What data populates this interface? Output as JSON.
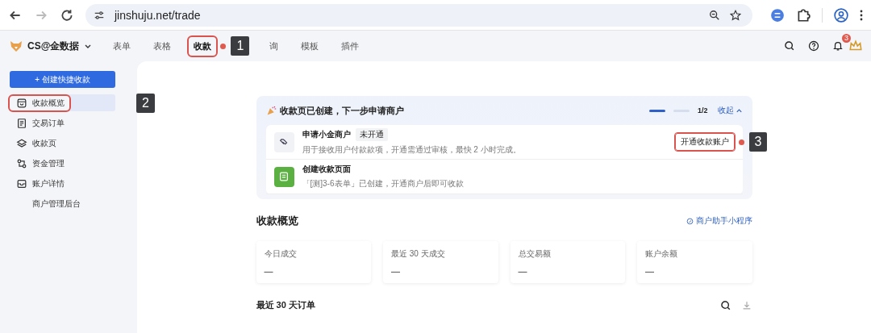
{
  "browser": {
    "url": "jinshuju.net/trade",
    "forward_disabled": true
  },
  "header": {
    "workspace": "CS@金数据",
    "notification_count": "3",
    "tabs": [
      {
        "label": "表单",
        "selected": false
      },
      {
        "label": "表格",
        "selected": false
      },
      {
        "label": "收款",
        "selected": true,
        "callout": "1"
      },
      {
        "label": "询",
        "selected": false
      },
      {
        "label": "模板",
        "selected": false
      },
      {
        "label": "插件",
        "selected": false
      }
    ]
  },
  "sidebar": {
    "create_button": "+ 创建快捷收款",
    "items": [
      {
        "label": "收款概览",
        "selected": true,
        "callout": "2"
      },
      {
        "label": "交易订单",
        "selected": false
      },
      {
        "label": "收款页",
        "selected": false
      },
      {
        "label": "资金管理",
        "selected": false
      },
      {
        "label": "账户详情",
        "selected": false
      },
      {
        "label": "商户管理后台",
        "selected": false
      }
    ]
  },
  "steps_panel": {
    "title": "收款页已创建，下一步申请商户",
    "progress": "1/2",
    "toggle": "收起",
    "expanded": true,
    "steps": [
      {
        "title": "申请小金商户",
        "badge": "未开通",
        "description": "用于接收用户付款款项，开通需通过审核，最快 2 小时完成。",
        "action": "开通收款账户",
        "action_callout": "3",
        "done": false
      },
      {
        "title": "创建收款页面",
        "description": "「[测]3-6表单」已创建，开通商户后即可收款",
        "done": true
      }
    ]
  },
  "overview": {
    "title": "收款概览",
    "link": "商户助手小程序",
    "stats": [
      {
        "label": "今日成交",
        "value": "—"
      },
      {
        "label": "最近 30 天成交",
        "value": "—"
      },
      {
        "label": "总交易额",
        "value": "—"
      },
      {
        "label": "账户余额",
        "value": "—"
      }
    ]
  },
  "orders": {
    "title": "最近 30 天订单"
  }
}
